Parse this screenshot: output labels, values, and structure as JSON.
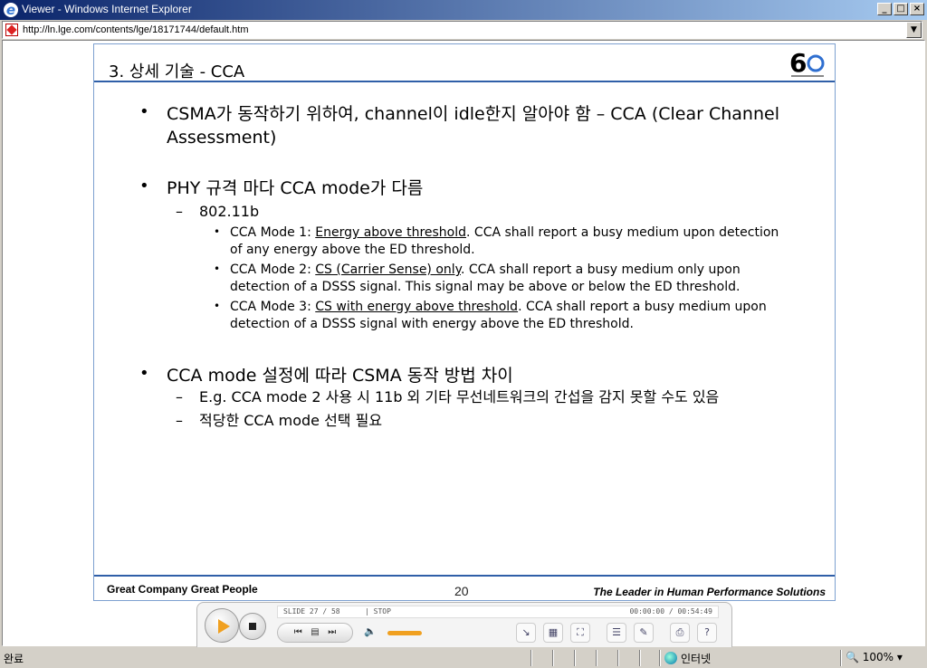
{
  "window": {
    "title": "Viewer - Windows Internet Explorer",
    "url": "http://ln.lge.com/contents/lge/18171744/default.htm"
  },
  "slide": {
    "title": "3. 상세 기술 - CCA",
    "bullets": [
      {
        "text": "CSMA가 동작하기 위하여, channel이 idle한지 알아야 함 – CCA (Clear Channel Assessment)"
      },
      {
        "text": "PHY 규격 마다 CCA mode가 다름"
      },
      {
        "sub": "802.11b"
      },
      {
        "modes": [
          {
            "prefix": "CCA Mode 1: ",
            "link": "Energy above threshold",
            "rest": ". CCA shall report a busy medium upon detection of any energy above the ED threshold."
          },
          {
            "prefix": "CCA Mode 2: ",
            "link": "CS (Carrier Sense) only",
            "rest": ". CCA shall report a busy medium only upon detection of a DSSS signal. This signal may be above or below the ED threshold."
          },
          {
            "prefix": "CCA Mode 3: ",
            "link": "CS with energy above threshold",
            "rest": ". CCA shall report a busy medium upon detection of a DSSS signal with energy above the ED threshold."
          }
        ]
      },
      {
        "text": "CCA mode 설정에 따라 CSMA 동작 방법 차이"
      },
      {
        "sub": "E.g. CCA mode 2 사용 시 11b 외 기타 무선네트워크의 간섭을 감지 못할 수도 있음"
      },
      {
        "sub": "적당한 CCA mode 선택 필요"
      }
    ],
    "footer_left": "Great Company   Great People",
    "page_number": "20",
    "footer_right": "The Leader in Human Performance Solutions"
  },
  "player": {
    "slide_counter": "SLIDE  27 / 58",
    "state": "| STOP",
    "time": "00:00:00 / 00:54:49",
    "volume_level": 1.0
  },
  "status": {
    "done": "완료",
    "zone": "인터넷",
    "zoom": "100%"
  },
  "colors": {
    "title_bar": "#0a246a",
    "slide_rule": "#2f5fa8",
    "accent": "#f0a020"
  }
}
